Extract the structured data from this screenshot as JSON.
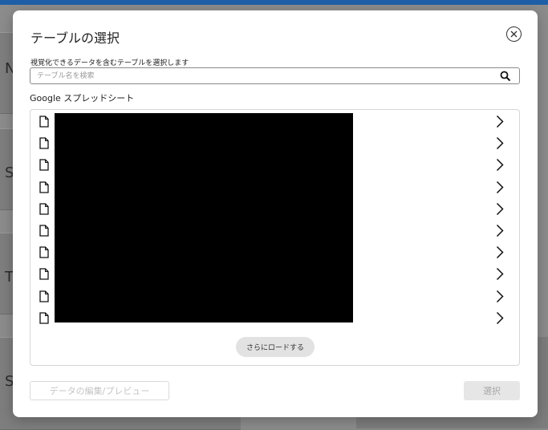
{
  "background": {
    "card_letters": [
      "N",
      "S",
      "T",
      "S"
    ]
  },
  "modal": {
    "title": "テーブルの選択",
    "close_icon": "close-icon",
    "subtitle": "視覚化できるデータを含むテーブルを選択します",
    "search": {
      "placeholder": "テーブル名を検索",
      "value": ""
    },
    "section_label": "Google スプレッドシート",
    "list": {
      "row_count": 10,
      "row_icon": "file-icon",
      "row_action_icon": "chevron-right-icon",
      "names_redacted": true
    },
    "load_more_label": "さらにロードする",
    "preview_button_label": "データの編集/プレビュー",
    "select_button_label": "選択"
  },
  "colors": {
    "topbar": "#1f5fa8",
    "overlay": "#8c8c8c",
    "disabled_text": "#c4c4c4"
  }
}
